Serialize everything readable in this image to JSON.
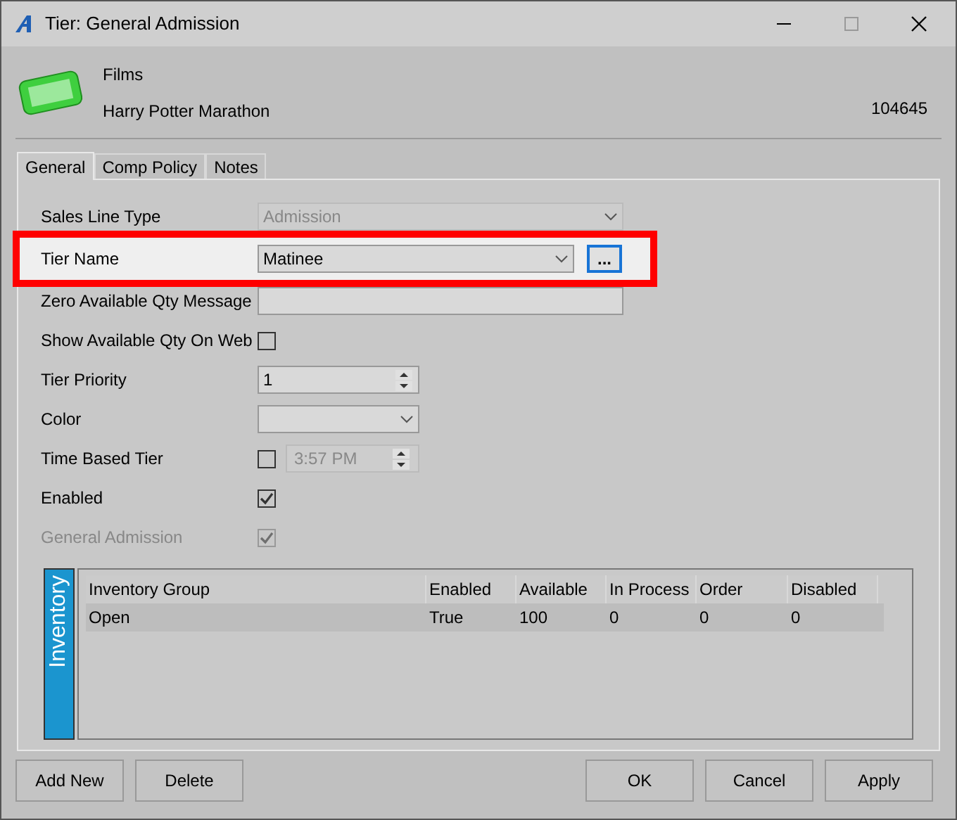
{
  "window": {
    "title": "Tier: General Admission"
  },
  "header": {
    "category": "Films",
    "event": "Harry Potter Marathon",
    "id": "104645"
  },
  "tabs": [
    {
      "label": "General",
      "selected": true
    },
    {
      "label": "Comp Policy",
      "selected": false
    },
    {
      "label": "Notes",
      "selected": false
    }
  ],
  "fields": [
    {
      "kind": "select",
      "label": "Sales Line Type",
      "value": "Admission",
      "disabled": true
    },
    {
      "kind": "select",
      "label": "Tier Name",
      "value": "Matinee",
      "highlighted": true,
      "browse": "..."
    },
    {
      "kind": "text",
      "label": "Zero Available Qty Message"
    },
    {
      "kind": "checkbox",
      "label": "Show Available Qty On Web",
      "checked": false
    },
    {
      "kind": "spin",
      "label": "Tier Priority",
      "value": "1"
    },
    {
      "kind": "select_small",
      "label": "Color"
    },
    {
      "kind": "checkbox_time",
      "label": "Time Based Tier",
      "checked": false,
      "time": "3:57 PM"
    },
    {
      "kind": "checkbox",
      "label": "Enabled",
      "checked": true
    },
    {
      "kind": "checkbox",
      "label": "General Admission",
      "checked": true,
      "disabled": true
    }
  ],
  "inventory": {
    "title": "Inventory",
    "columns": [
      "Inventory Group",
      "Enabled",
      "Available",
      "In Process",
      "Order",
      "Disabled"
    ],
    "rows": [
      [
        "Open",
        "True",
        "100",
        "0",
        "0",
        "0"
      ]
    ]
  },
  "buttons_left": [
    "Add New",
    "Delete"
  ],
  "buttons_right": [
    "OK",
    "Cancel",
    "Apply"
  ]
}
